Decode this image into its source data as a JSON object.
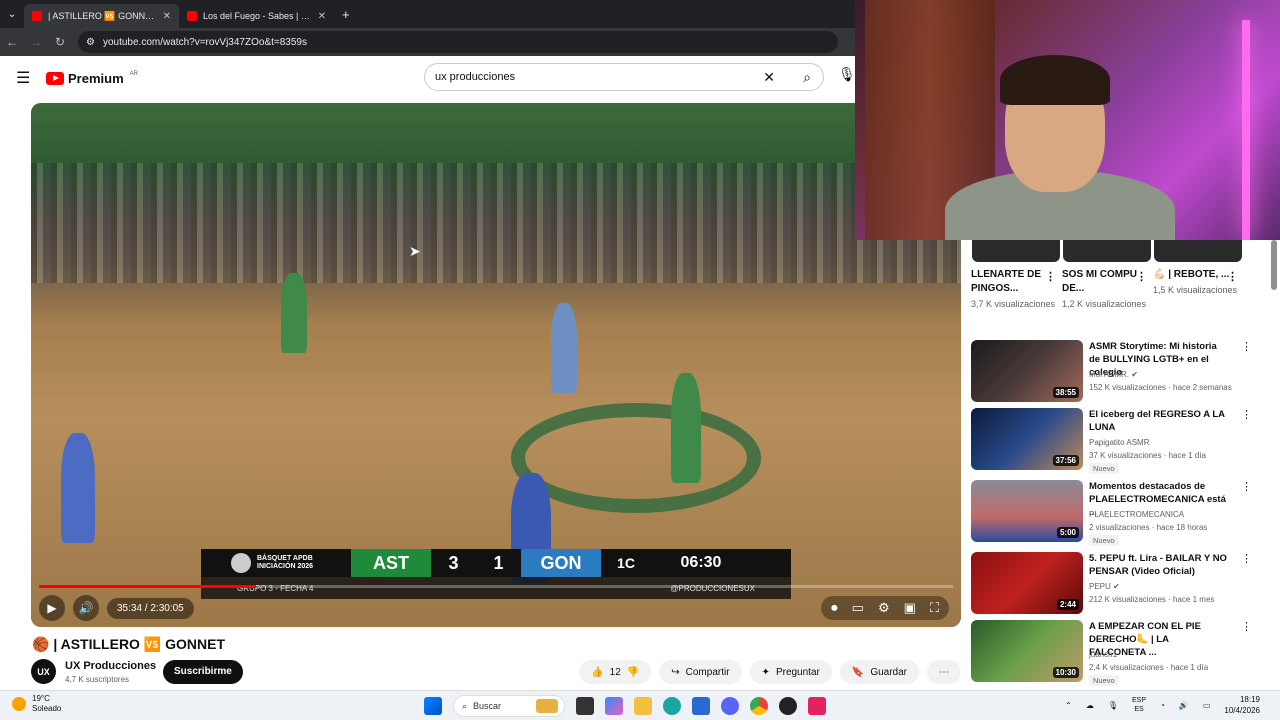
{
  "browser": {
    "tabs": [
      {
        "label": "| ASTILLERO 🆚 GONNET -",
        "active": true
      },
      {
        "label": "Los del Fuego - Sabes | Exito de",
        "active": false
      }
    ],
    "new_tab": "+",
    "url": "youtube.com/watch?v=rovVj347ZOo&t=8359s"
  },
  "youtube": {
    "logo_text": "Premium",
    "region": "AR",
    "search_value": "ux producciones"
  },
  "video": {
    "time": "35:34 / 2:30:05",
    "progress_fraction": 0.237,
    "scoreboard": {
      "league_line1": "BÁSQUET APDB",
      "league_line2": "INICIACIÓN 2026",
      "home": "AST",
      "home_score": "3",
      "away_score": "1",
      "away": "GON",
      "quarter": "1C",
      "clock": "06:30",
      "group": "GRUPO 3 - FECHA 4",
      "handle": "@PRODUCCIONESUX"
    },
    "title": "🏀 | ASTILLERO 🆚 GONNET"
  },
  "channel": {
    "avatar": "UX",
    "name": "UX Producciones",
    "subs": "4,7 K suscriptores",
    "subscribe": "Suscribirme"
  },
  "actions": {
    "likes": "12",
    "share": "Compartir",
    "ask": "Preguntar",
    "save": "Guardar"
  },
  "shorts": [
    {
      "title": "LLENARTE DE PINGOS...",
      "views": "3,7 K visualizaciones"
    },
    {
      "title": "SOS MI COMPU DE...",
      "views": "1,2 K visualizaciones"
    },
    {
      "title": "💪🏻 | REBOTE, ...",
      "views": "1,5 K visualizaciones"
    }
  ],
  "recommendations": [
    {
      "title": "ASMR Storytime: Mi historia de BULLYING LGTB+ en el colegio",
      "channel": "Mol ASMR.",
      "meta": "152 K visualizaciones · hace 2 semanas",
      "duration": "38:55",
      "badge": ""
    },
    {
      "title": "El iceberg del REGRESO A LA LUNA",
      "channel": "Papigatito ASMR",
      "meta": "37 K visualizaciones · hace 1 día",
      "duration": "37:56",
      "badge": "Nuevo"
    },
    {
      "title": "Momentos destacados de PLAELECTROMECANICA está ...",
      "channel": "PLAELECTROMECANICA",
      "meta": "2 visualizaciones · hace 18 horas",
      "duration": "5:00",
      "badge": "Nuevo"
    },
    {
      "title": "5. PEPU ft. Lira - BAILAR Y NO PENSAR (Video Oficial)",
      "channel": "PEPU",
      "meta": "212 K visualizaciones · hace 1 mes",
      "duration": "2:44",
      "badge": ""
    },
    {
      "title": "A EMPEZAR CON EL PIE DERECHO🦶 | LA FALCONETA ...",
      "channel": "juanch1",
      "meta": "2,4 K visualizaciones · hace 1 día",
      "duration": "10:30",
      "badge": "Nuevo"
    }
  ],
  "taskbar": {
    "temp": "19°C",
    "weather": "Soleado",
    "search": "Buscar",
    "lang1": "ESP",
    "lang2": "ES",
    "time": "18:19",
    "date": "10/4/2026"
  }
}
